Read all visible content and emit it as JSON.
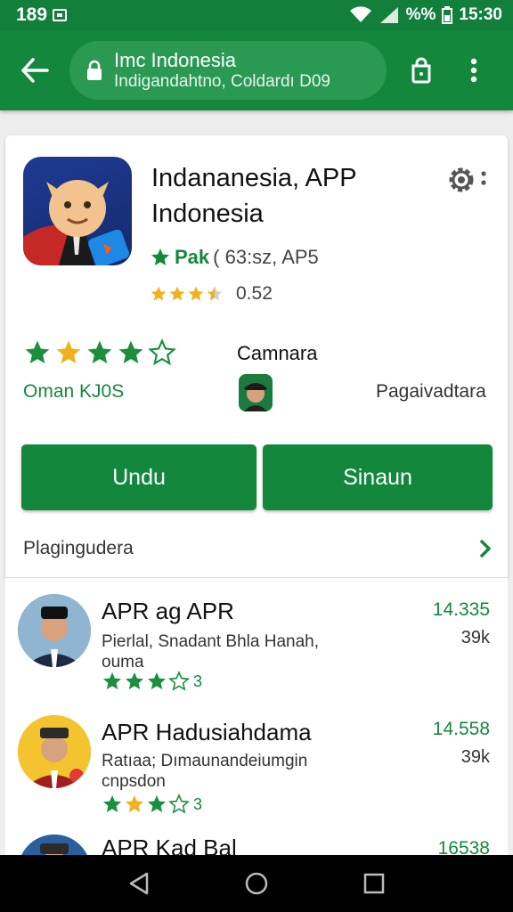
{
  "status_bar": {
    "left_text": "189",
    "battery_text": "%%",
    "time": "15:30"
  },
  "url_bar": {
    "title": "Imc Indonesia",
    "subtitle": "Indigandahtno, Coldardı D09"
  },
  "app": {
    "title_line1": "Indananesia, APP",
    "title_line2": "Indonesia",
    "pak_label": "Pak",
    "pak_extra": "( 63:sz, AP5",
    "rating_value": "0.52",
    "rating_stars": 3.5,
    "big_rating_stars": 4,
    "omah": "Oman KJ0S",
    "camera_label": "Camnara",
    "pagav_label": "Pagaivadtara",
    "install_label": "Undu",
    "share_label": "Sinaun",
    "more_label": "Plagingudera"
  },
  "list": [
    {
      "title": "APR ag APR",
      "desc1": "Pierlal, Snadant Bhla Hanah,",
      "desc2": "ouma",
      "stars": 3,
      "count": "3",
      "price": "14.335",
      "size": "39k"
    },
    {
      "title": "APR Hadusiahdama",
      "desc1": "Ratıaa; Dımaunandeiumgin",
      "desc2": "cnpsdon",
      "stars": 3,
      "count": "3",
      "price": "14.558",
      "size": "39k"
    },
    {
      "title": "APR Kad Bal",
      "desc1": "",
      "desc2": "",
      "stars": 0,
      "count": "",
      "price": "16538",
      "size": ""
    }
  ],
  "colors": {
    "brand_green": "#13883d",
    "star_gold": "#f2b01e",
    "star_green": "#1a8f3e"
  }
}
